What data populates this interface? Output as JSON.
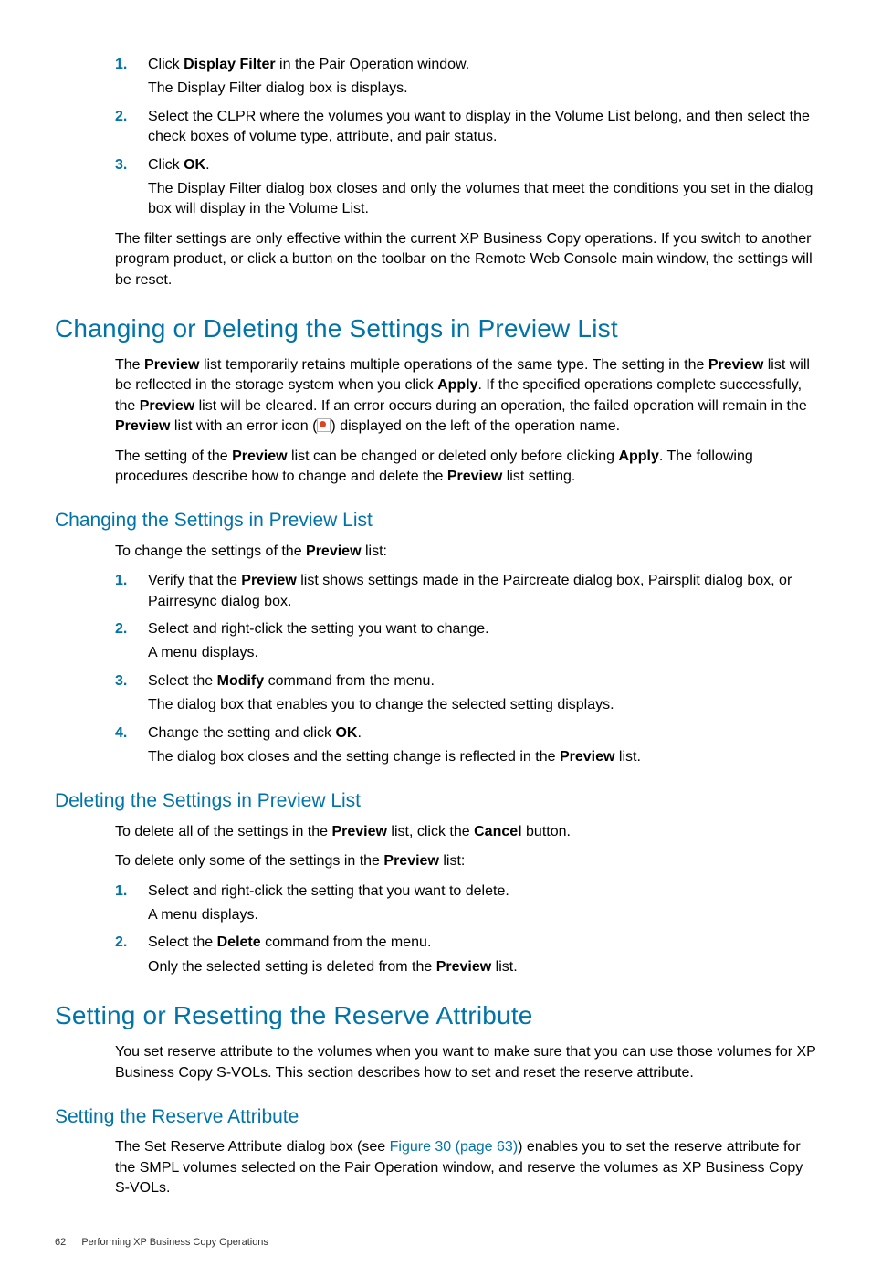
{
  "ol1": {
    "n1": "1.",
    "s1a": "Click ",
    "s1b": "Display Filter",
    "s1c": " in the Pair Operation window.",
    "s1sub": "The Display Filter dialog box is displays.",
    "n2": "2.",
    "s2": "Select the CLPR where the volumes you want to display in the Volume List belong, and then select the check boxes of volume type, attribute, and pair status.",
    "n3": "3.",
    "s3a": "Click ",
    "s3b": "OK",
    "s3c": ".",
    "s3sub": "The Display Filter dialog box closes and only the volumes that meet the conditions you set in the dialog box will display in the Volume List."
  },
  "p_filter_note": "The filter settings are only effective within the current XP Business Copy operations. If you switch to another program product, or click a button on the toolbar on the Remote Web Console main window, the settings will be reset.",
  "h1a": "Changing or Deleting the Settings in Preview List",
  "pcd": {
    "a": "The ",
    "b": "Preview",
    "c": " list temporarily retains multiple operations of the same type. The setting in the ",
    "d": "Preview",
    "e": " list will be reflected in the storage system when you click ",
    "f": "Apply",
    "g": ". If the specified operations complete successfully, the ",
    "h": "Preview",
    "i": " list will be cleared. If an error occurs during an operation, the failed operation will remain in the ",
    "j": "Preview",
    "k": " list with an error icon (",
    "l": ") displayed on the left of the operation name."
  },
  "pcd2": {
    "a": "The setting of the ",
    "b": "Preview",
    "c": " list can be changed or deleted only before clicking ",
    "d": "Apply",
    "e": ". The following procedures describe how to change and delete the ",
    "f": "Preview",
    "g": " list setting."
  },
  "h2a": "Changing the Settings in Preview List",
  "pch_intro": {
    "a": "To change the settings of the ",
    "b": "Preview",
    "c": " list:"
  },
  "ol2": {
    "n1": "1.",
    "s1a": "Verify that the ",
    "s1b": "Preview",
    "s1c": " list shows settings made in the Paircreate dialog box, Pairsplit dialog box, or Pairresync dialog box.",
    "n2": "2.",
    "s2": "Select and right-click the setting you want to change.",
    "s2sub": "A menu displays.",
    "n3": "3.",
    "s3a": "Select the ",
    "s3b": "Modify",
    "s3c": " command from the menu.",
    "s3sub": "The dialog box that enables you to change the selected setting displays.",
    "n4": "4.",
    "s4a": "Change the setting and click ",
    "s4b": "OK",
    "s4c": ".",
    "s4suba": "The dialog box closes and the setting change is reflected in the ",
    "s4subb": "Preview",
    "s4subc": " list."
  },
  "h2b": "Deleting the Settings in Preview List",
  "pdel1": {
    "a": "To delete all of the settings in the ",
    "b": "Preview",
    "c": " list, click the ",
    "d": "Cancel",
    "e": " button."
  },
  "pdel2": {
    "a": "To delete only some of the settings in the ",
    "b": "Preview",
    "c": " list:"
  },
  "ol3": {
    "n1": "1.",
    "s1": "Select and right-click the setting that you want to delete.",
    "s1sub": "A menu displays.",
    "n2": "2.",
    "s2a": "Select the ",
    "s2b": "Delete",
    "s2c": " command from the menu.",
    "s2suba": "Only the selected setting is deleted from the ",
    "s2subb": "Preview",
    "s2subc": " list."
  },
  "h1b": "Setting or Resetting the Reserve Attribute",
  "pres": "You set reserve attribute to the volumes when you want to make sure that you can use those volumes for XP Business Copy S-VOLs. This section describes how to set and reset the reserve attribute.",
  "h2c": "Setting the Reserve Attribute",
  "pset": {
    "a": "The Set Reserve Attribute dialog box (see ",
    "b": "Figure 30 (page 63)",
    "c": ") enables you to set the reserve attribute for the SMPL volumes selected on the Pair Operation window, and reserve the volumes as XP Business Copy S-VOLs."
  },
  "footer": {
    "page": "62",
    "title": "Performing XP Business Copy Operations"
  }
}
